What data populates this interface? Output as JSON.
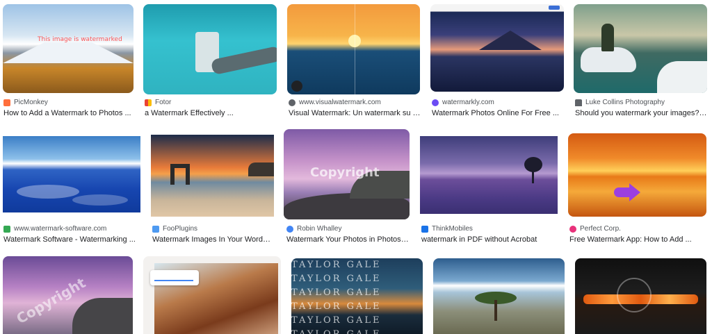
{
  "results": [
    {
      "source": "PicMonkey",
      "title": "How to Add a Watermark to Photos ...",
      "overlay": "This image is watermarked",
      "favicon_color": "#ff6f3c"
    },
    {
      "source": "Fotor",
      "title": "a Watermark Effectively ...",
      "overlay": "",
      "favicon_color": "#f4b400"
    },
    {
      "source": "www.visualwatermark.com",
      "title": "Visual Watermark: Un watermark su 1...",
      "overlay": "",
      "favicon_color": "#5f6368"
    },
    {
      "source": "watermarkly.com",
      "title": "Watermark Photos Online For Free ...",
      "overlay": "",
      "favicon_color": "#6c4cf4"
    },
    {
      "source": "Luke Collins Photography",
      "title": "Should you watermark your images? ...",
      "overlay": "",
      "favicon_color": "#5f6368"
    },
    {
      "source": "www.watermark-software.com",
      "title": "Watermark Software - Watermarking ...",
      "overlay": "",
      "favicon_color": "#34a853"
    },
    {
      "source": "FooPlugins",
      "title": "Watermark Images In Your WordPr...",
      "overlay": "",
      "favicon_color": "#4e9af1"
    },
    {
      "source": "Robin Whalley",
      "title": "Watermark Your Photos in Photosh...",
      "overlay": "Copyright",
      "favicon_color": "#4285f4"
    },
    {
      "source": "ThinkMobiles",
      "title": "watermark in PDF without Acrobat",
      "overlay": "",
      "favicon_color": "#1a73e8"
    },
    {
      "source": "Perfect Corp.",
      "title": "Free Watermark App: How to Add ...",
      "overlay": "",
      "favicon_color": "#e8317a"
    },
    {
      "overlay": "Copyright"
    },
    {
      "overlay": ""
    },
    {
      "overlay": "TAYLOR GALE"
    },
    {
      "overlay": ""
    },
    {
      "overlay": ""
    }
  ]
}
